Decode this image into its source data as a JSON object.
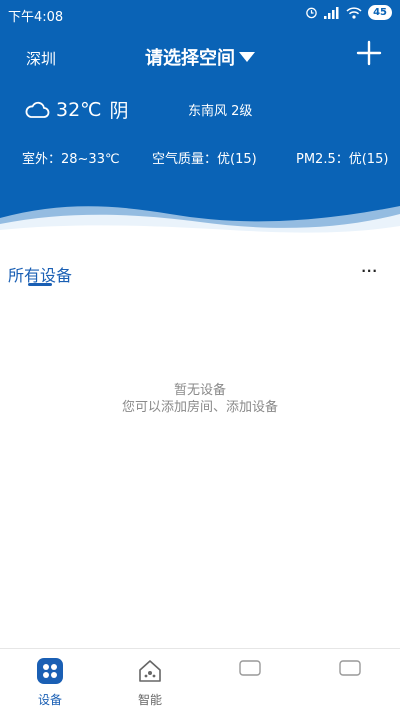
{
  "status_bar": {
    "time": "下午4:08",
    "battery": "45"
  },
  "header": {
    "city": "深圳",
    "room_select_label": "请选择空间",
    "weather": {
      "temperature": "32℃",
      "condition": "阴",
      "wind": "东南风 2级"
    },
    "stats": {
      "outdoor": "室外：28~33℃",
      "air_quality": "空气质量：优(15)",
      "pm25": "PM2.5：优(15)"
    }
  },
  "section": {
    "title": "所有设备",
    "more": "···"
  },
  "empty_state": {
    "line1": "暂无设备",
    "line2": "您可以添加房间、添加设备"
  },
  "tabs": [
    {
      "label": "设备",
      "icon": "devices-icon",
      "active": true
    },
    {
      "label": "智能",
      "icon": "smart-home-icon",
      "active": false
    },
    {
      "label": "",
      "icon": "tab-icon",
      "active": false
    },
    {
      "label": "",
      "icon": "tab-icon",
      "active": false
    }
  ],
  "colors": {
    "brand": "#0a63b6",
    "accent": "#1a5fb4"
  }
}
